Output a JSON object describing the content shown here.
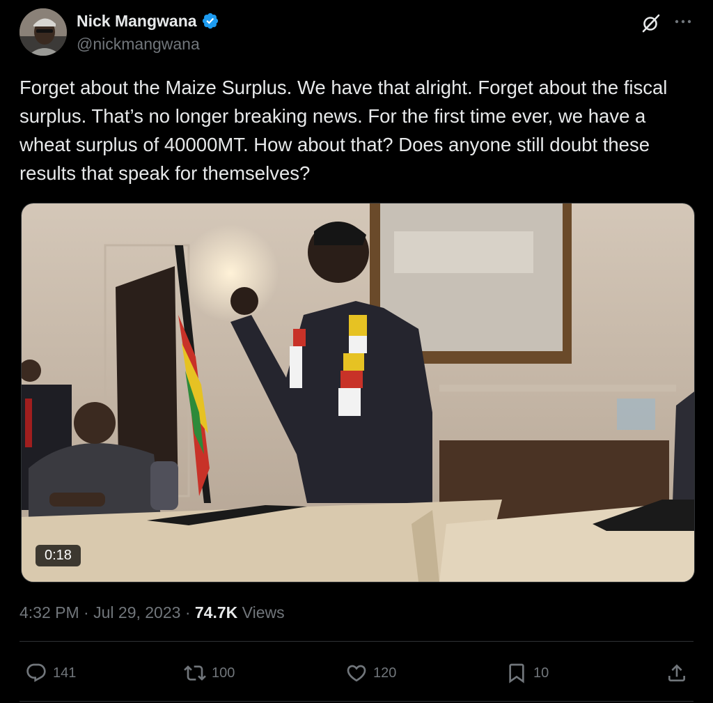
{
  "author": {
    "display_name": "Nick Mangwana",
    "handle": "@nickmangwana",
    "verified": true
  },
  "header_icons": [
    "grok-icon",
    "more-options-icon"
  ],
  "tweet": {
    "text": "Forget about the Maize Surplus. We have that alright. Forget about the fiscal surplus. That’s no longer breaking news. For the first time ever, we have a wheat surplus of 40000MT. How about that? Does anyone still doubt these results that speak for themselves?"
  },
  "media": {
    "type": "video",
    "duration": "0:18"
  },
  "meta": {
    "time": "4:32 PM",
    "separator": "·",
    "date": "Jul 29, 2023",
    "views_count": "74.7K",
    "views_label": "Views"
  },
  "actions": {
    "replies": "141",
    "reposts": "100",
    "likes": "120",
    "bookmarks": "10"
  },
  "colors": {
    "background": "#000000",
    "text_primary": "#e7e9ea",
    "text_secondary": "#71767b",
    "divider": "#2f3336",
    "verified_badge": "#1d9bf0"
  }
}
